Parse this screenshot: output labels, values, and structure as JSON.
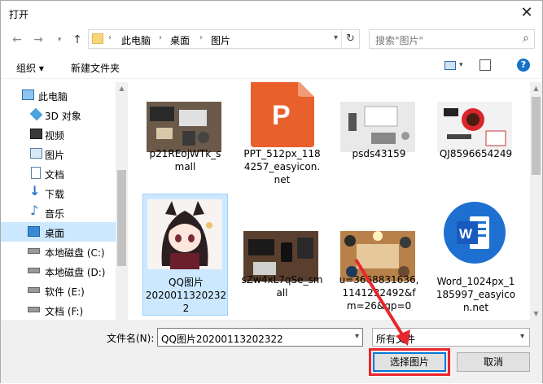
{
  "window": {
    "title": "打开"
  },
  "address": {
    "crumbs": [
      "此电脑",
      "桌面",
      "图片"
    ]
  },
  "search": {
    "placeholder": "搜索\"图片\""
  },
  "toolbar": {
    "organize": "组织 ▾",
    "new_folder": "新建文件夹"
  },
  "nav": {
    "items": [
      {
        "label": "此电脑",
        "icon": "computer-icon"
      },
      {
        "label": "3D 对象",
        "icon": "cube-3d-icon"
      },
      {
        "label": "视频",
        "icon": "video-icon"
      },
      {
        "label": "图片",
        "icon": "picture-icon"
      },
      {
        "label": "文档",
        "icon": "document-icon"
      },
      {
        "label": "下载",
        "icon": "download-icon"
      },
      {
        "label": "音乐",
        "icon": "music-icon"
      },
      {
        "label": "桌面",
        "icon": "desktop-icon",
        "selected": true
      },
      {
        "label": "本地磁盘 (C:)",
        "icon": "drive-icon"
      },
      {
        "label": "本地磁盘 (D:)",
        "icon": "drive-icon"
      },
      {
        "label": "软件 (E:)",
        "icon": "drive-icon"
      },
      {
        "label": "文档 (F:)",
        "icon": "drive-icon"
      }
    ]
  },
  "files": [
    {
      "name": "p21REojWTk_s\nmall",
      "thumb": "desk-photo"
    },
    {
      "name": "PPT_512px_118\n4257_easyicon.\nnet",
      "thumb": "ppt-icon"
    },
    {
      "name": "psds43159",
      "thumb": "office-photo"
    },
    {
      "name": "QJ8596654249",
      "thumb": "red-cup-photo"
    },
    {
      "name": "QQ图片\n2020011320232\n2",
      "thumb": "anime-girl",
      "selected": true
    },
    {
      "name": "sZw4xL7qSe_sm\nall",
      "thumb": "laptop-photo"
    },
    {
      "name": "u=3668831636,\n1141232492&f\nm=26&gp=0",
      "thumb": "meeting-photo"
    },
    {
      "name": "Word_1024px_1\n185997_easyico\nn.net",
      "thumb": "word-icon"
    }
  ],
  "bottom": {
    "filename_label": "文件名(N):",
    "filename_value": "QQ图片20200113202322",
    "filetype_value": "所有文件",
    "open_label": "选择图片",
    "cancel_label": "取消"
  },
  "colors": {
    "selection": "#cce8ff",
    "accent": "#0078d7",
    "annotation_red": "#e8262d"
  }
}
